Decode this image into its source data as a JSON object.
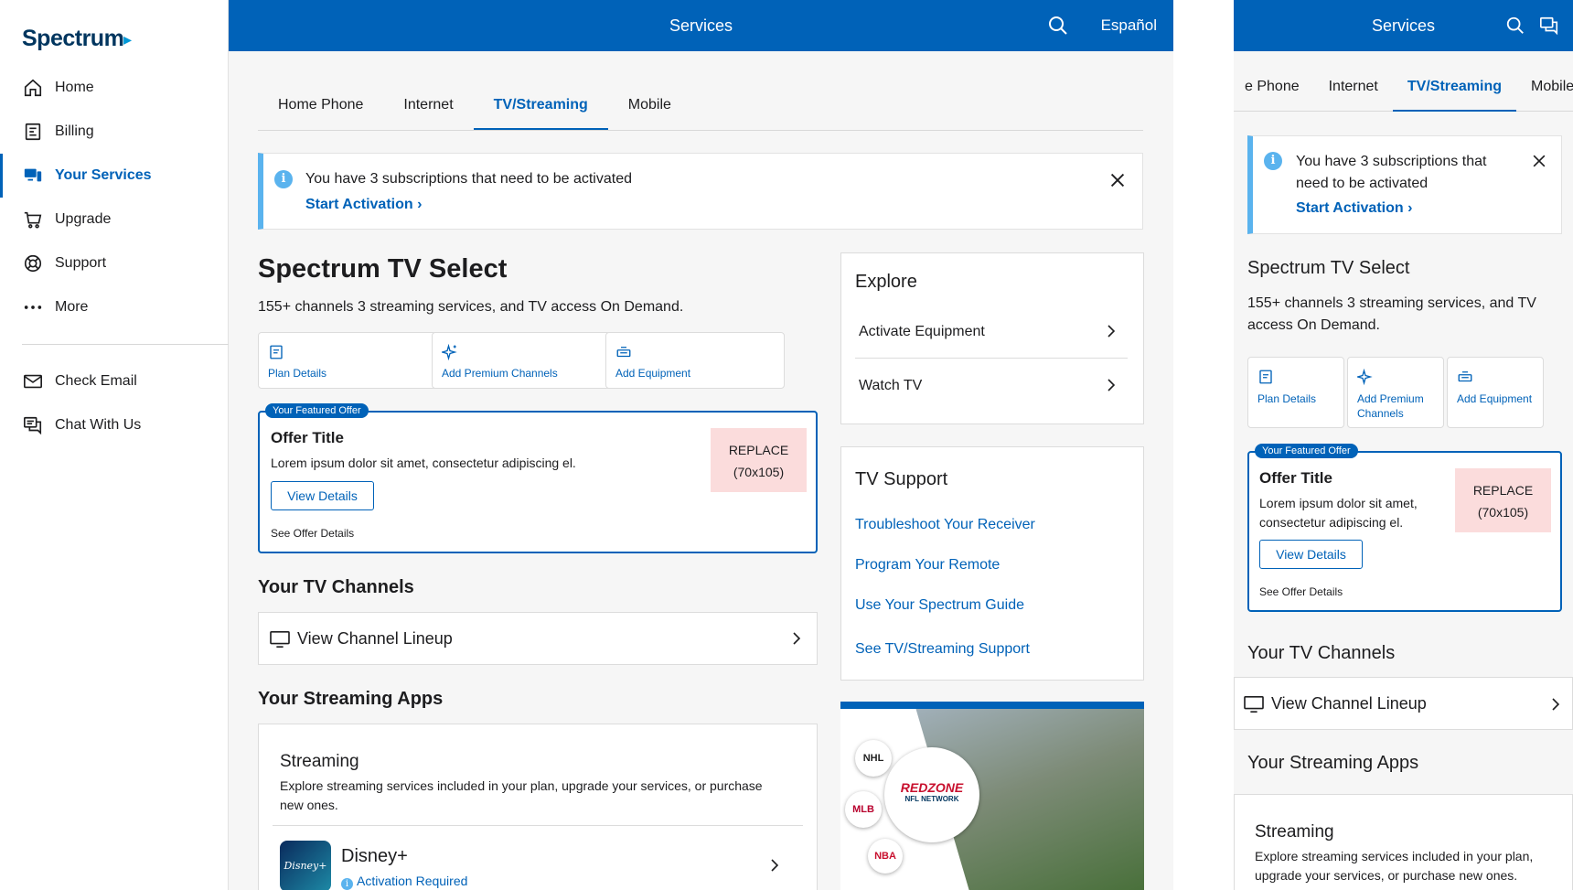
{
  "brand": {
    "logo_text": "Spectrum",
    "colors": {
      "primary": "#0062b8",
      "info": "#5ab3ee",
      "placeholder": "#fbdcdc"
    }
  },
  "sidebar": {
    "items": [
      {
        "label": "Home",
        "icon": "home-icon"
      },
      {
        "label": "Billing",
        "icon": "billing-icon"
      },
      {
        "label": "Your Services",
        "icon": "services-icon",
        "active": true
      },
      {
        "label": "Upgrade",
        "icon": "cart-icon"
      },
      {
        "label": "Support",
        "icon": "lifebuoy-icon"
      },
      {
        "label": "More",
        "icon": "more-icon"
      }
    ],
    "secondary": [
      {
        "label": "Check Email",
        "icon": "mail-icon"
      },
      {
        "label": "Chat With Us",
        "icon": "chat-icon"
      }
    ]
  },
  "header": {
    "title": "Services",
    "language": "Español"
  },
  "tabs": [
    {
      "label": "Home Phone"
    },
    {
      "label": "Internet"
    },
    {
      "label": "TV/Streaming",
      "active": true
    },
    {
      "label": "Mobile"
    }
  ],
  "alert": {
    "message": "You have 3 subscriptions that need to be activated",
    "link": "Start Activation"
  },
  "plan": {
    "title": "Spectrum TV Select",
    "description": "155+ channels 3 streaming services, and TV access On Demand.",
    "actions": [
      {
        "label": "Plan Details",
        "icon": "document-icon"
      },
      {
        "label": "Add Premium Channels",
        "icon": "sparkle-icon"
      },
      {
        "label": "Add Equipment",
        "icon": "receiver-icon"
      }
    ]
  },
  "offer": {
    "badge": "Your Featured Offer",
    "title": "Offer Title",
    "description": "Lorem ipsum dolor sit amet, consectetur adipiscing el.",
    "button": "View Details",
    "link": "See Offer Details",
    "image_placeholder_line1": "REPLACE",
    "image_placeholder_line2": "(70x105)"
  },
  "channels": {
    "heading": "Your TV Channels",
    "lineup_label": "View Channel Lineup"
  },
  "streaming": {
    "heading": "Your Streaming Apps",
    "card_title": "Streaming",
    "card_description": "Explore streaming services included in your plan, upgrade your services, or purchase new ones.",
    "apps": [
      {
        "name": "Disney+",
        "status": "Activation Required",
        "logo_text": "Disney+"
      }
    ]
  },
  "explore": {
    "heading": "Explore",
    "items": [
      {
        "label": "Activate Equipment"
      },
      {
        "label": "Watch TV"
      }
    ]
  },
  "tv_support": {
    "heading": "TV Support",
    "links": [
      {
        "label": "Troubleshoot Your Receiver"
      },
      {
        "label": "Program Your Remote"
      },
      {
        "label": "Use Your Spectrum Guide"
      },
      {
        "label": "See TV/Streaming Support"
      }
    ]
  },
  "promo": {
    "badges": [
      "NHL",
      "MLB",
      "NBA"
    ],
    "center_line1": "REDZONE",
    "center_line2": "NFL NETWORK"
  },
  "mobile": {
    "first_tab_partial": "e Phone"
  }
}
